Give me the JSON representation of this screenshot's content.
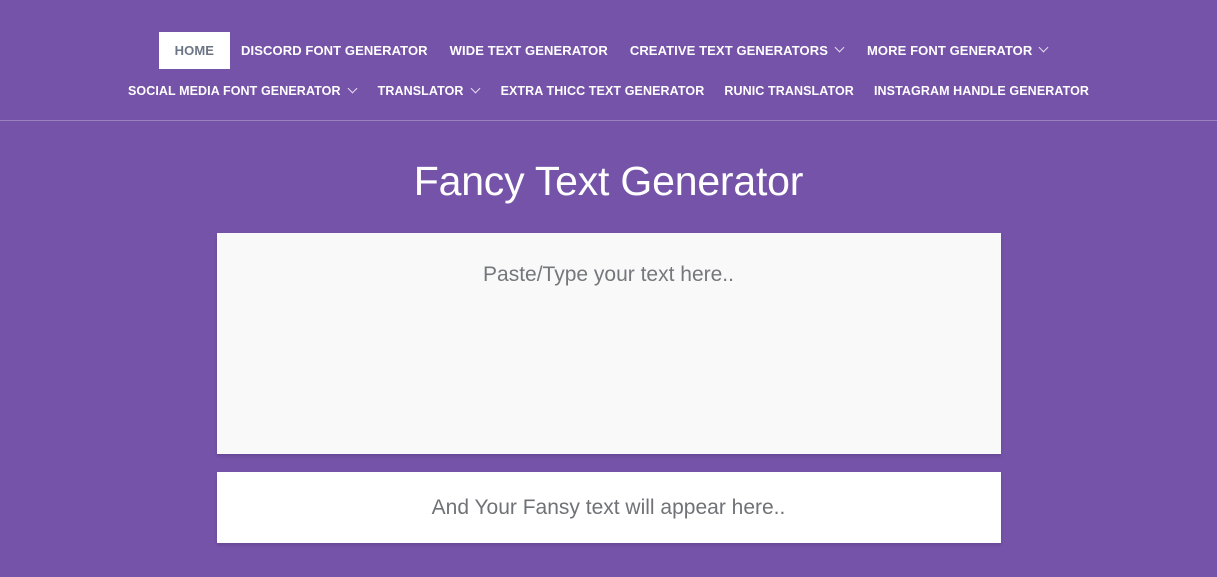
{
  "site": {
    "brand_color": "#7553a8",
    "nav_text_color": "#ffffff",
    "active_tab_bg": "#ffffff",
    "active_tab_text_color": "#6b7585",
    "panel_bg": "#f9f9f9",
    "output_bg": "#ffffff",
    "placeholder_color": "#75777c"
  },
  "nav": {
    "row1": [
      {
        "label": "HOME",
        "active": true,
        "has_dropdown": false
      },
      {
        "label": "DISCORD FONT GENERATOR",
        "active": false,
        "has_dropdown": false
      },
      {
        "label": "WIDE TEXT GENERATOR",
        "active": false,
        "has_dropdown": false
      },
      {
        "label": "CREATIVE TEXT GENERATORS",
        "active": false,
        "has_dropdown": true
      },
      {
        "label": "MORE FONT GENERATOR",
        "active": false,
        "has_dropdown": true
      }
    ],
    "row2": [
      {
        "label": "SOCIAL MEDIA FONT GENERATOR",
        "active": false,
        "has_dropdown": true
      },
      {
        "label": "TRANSLATOR",
        "active": false,
        "has_dropdown": true
      },
      {
        "label": "EXTRA THICC TEXT GENERATOR",
        "active": false,
        "has_dropdown": false
      },
      {
        "label": "RUNIC TRANSLATOR",
        "active": false,
        "has_dropdown": false
      },
      {
        "label": "INSTAGRAM HANDLE GENERATOR",
        "active": false,
        "has_dropdown": false
      }
    ]
  },
  "main": {
    "title": "Fancy Text Generator",
    "input": {
      "placeholder": "Paste/Type your text here..",
      "value": ""
    },
    "output": {
      "text": "And Your Fansy text will appear here.."
    }
  }
}
